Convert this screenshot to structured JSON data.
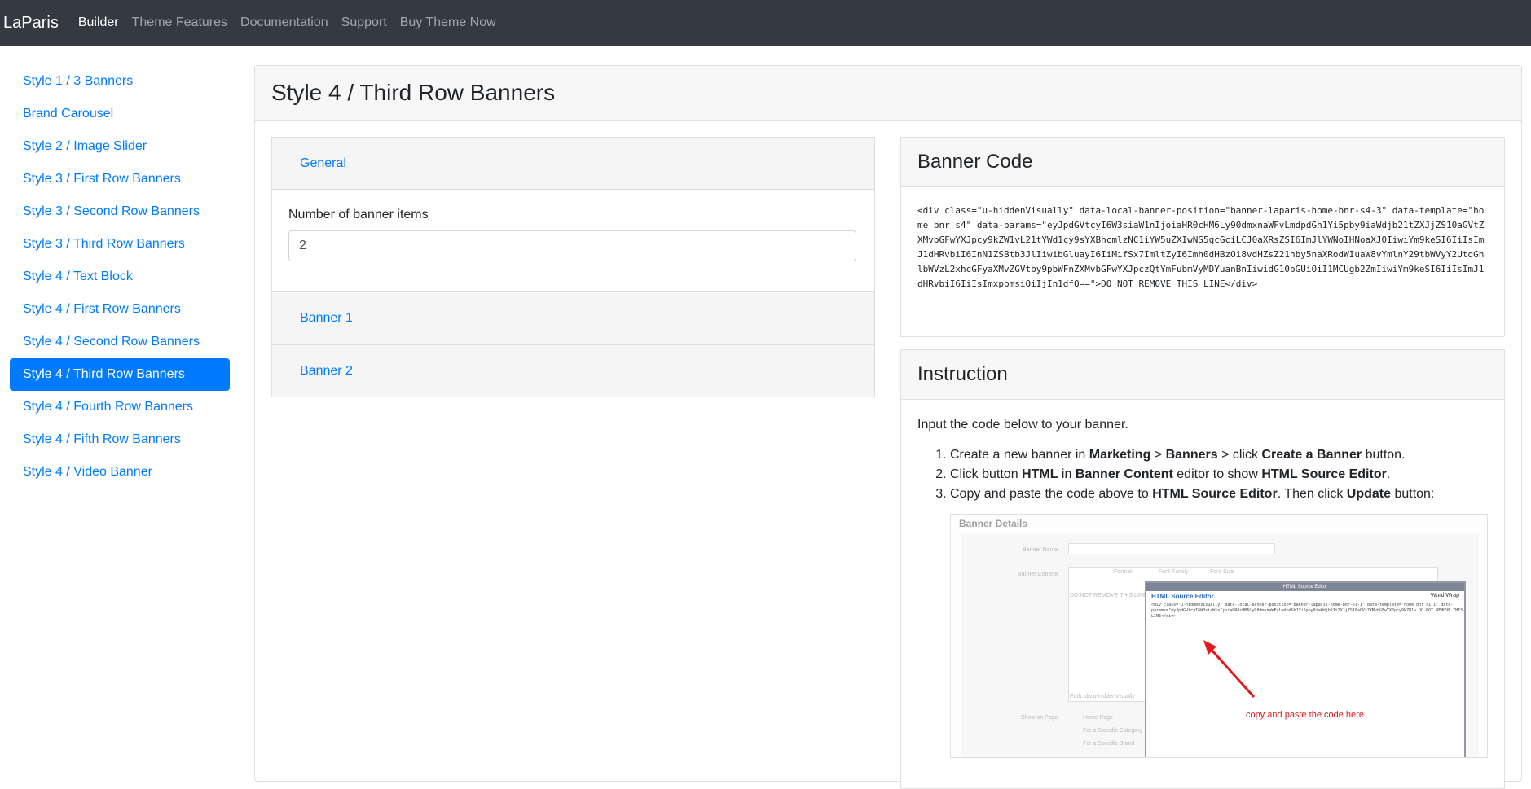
{
  "navbar": {
    "brand": "LaParis",
    "links": [
      "Builder",
      "Theme Features",
      "Documentation",
      "Support",
      "Buy Theme Now"
    ]
  },
  "sidebar": {
    "items": [
      "Style 1 / 3 Banners",
      "Brand Carousel",
      "Style 2 / Image Slider",
      "Style 3 / First Row Banners",
      "Style 3 / Second Row Banners",
      "Style 3 / Third Row Banners",
      "Style 4 / Text Block",
      "Style 4 / First Row Banners",
      "Style 4 / Second Row Banners",
      "Style 4 / Third Row Banners",
      "Style 4 / Fourth Row Banners",
      "Style 4 / Fifth Row Banners",
      "Style 4 / Video Banner"
    ],
    "active_index": 9
  },
  "main": {
    "title": "Style 4 / Third Row Banners",
    "accordion": {
      "general_label": "General",
      "field_label": "Number of banner items",
      "field_value": "2",
      "banners": [
        "Banner 1",
        "Banner 2"
      ]
    }
  },
  "banner_code": {
    "title": "Banner Code",
    "code": "<div class=\"u-hiddenVisually\" data-local-banner-position=\"banner-laparis-home-bnr-s4-3\" data-template=\"home_bnr_s4\" data-params=\"eyJpdGVtcyI6W3siaW1nIjoiaHR0cHM6Ly90dmxnaWFvLmdpdGh1Yi5pby9iaWdjb21tZXJjZS10aGVtZXMvbGFwYXJpcy9kZW1vL21tYWd1cy9sYXBhcmlzNC1iYW5uZXIwNS5qcGciLCJ0aXRsZSI6ImJlYWNoIHNoaXJ0IiwiYm9keSI6IiIsImJ1dHRvbiI6InN1ZSBtb3JlIiwibGluayI6IiMifSx7ImltZyI6Imh0dHBzOi8vdHZsZ21hby5naXRodWIuaW8vYmlnY29tbWVyY2UtdGhlbWVzL2xhcGFyaXMvZGVtby9pbWFnZXMvbGFwYXJpczQtYmFubmVyMDYuanBnIiwidG10bGUiOiI1MCUgb2ZmIiwiYm9keSI6IiIsImJ1dHRvbiI6IiIsImxpbmsiOiIjIn1dfQ==\">DO NOT REMOVE THIS LINE</div>"
  },
  "instruction": {
    "title": "Instruction",
    "intro": "Input the code below to your banner.",
    "steps": [
      [
        "Create a new banner in ",
        "Marketing",
        " > ",
        "Banners",
        " > click ",
        "Create a Banner",
        " button."
      ],
      [
        "Click button ",
        "HTML",
        " in ",
        "Banner Content",
        " editor to show ",
        "HTML Source Editor",
        "."
      ],
      [
        "Copy and paste the code above to ",
        "HTML Source Editor",
        ". Then click ",
        "Update",
        " button:"
      ]
    ],
    "screenshot": {
      "heading": "Banner Details",
      "field_banner_name": "Banner Name",
      "field_banner_content": "Banner Content",
      "field_show_on_page": "Show on Page",
      "option_home_page": "Home Page",
      "option_category": "For a Specific Category",
      "option_brand": "For a Specific Brand",
      "path_text": "Path: div.u-hiddenVisually",
      "do_not_remove": "DO NOT REMOVE THIS LINE",
      "editor_bar": "HTML Source Editor",
      "editor_title": "HTML Source Editor",
      "word_wrap": "Word Wrap",
      "editor_code": "<div class=\"u-hiddenVisually\" data-local-banner-position=\"banner-laparis-home-bnr-s1-1\" data-template=\"home_bnr_s1_1\" data-params=\"eyJpdGVtcyI6W3siaW1nIjoiaHR0cHM6Ly90dmxnaWFvLmdpdGh1Yi5pby9iaWdjb21tZXJjZS10aGVtZXMvbGFwYXJpcy9kZW1v DO NOT REMOVE THIS LINE</div>",
      "callout": "copy and paste the code here",
      "toolbar_format": "Format",
      "toolbar_font_family": "Font Family",
      "toolbar_font_size": "Font Size"
    }
  },
  "colors": {
    "navbar_bg": "#343a40",
    "link_blue": "#007bff",
    "arrow_red": "#e0191f"
  }
}
